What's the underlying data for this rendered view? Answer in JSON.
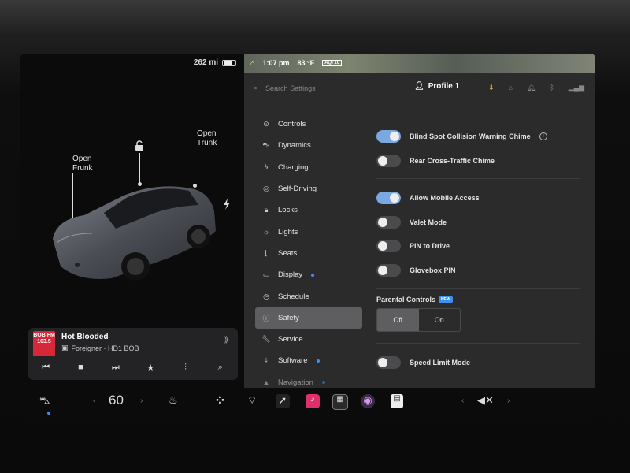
{
  "status": {
    "range": "262 mi",
    "time": "1:07 pm",
    "temp": "83 °F",
    "aqi": "AQI 10"
  },
  "car": {
    "frunk_label": "Open\nFrunk",
    "trunk_label": "Open\nTrunk"
  },
  "media": {
    "station_logo": "BOB FM 103.5",
    "song": "Hot Blooded",
    "artist": "Foreigner · HD1 BOB"
  },
  "settings": {
    "search_placeholder": "Search Settings",
    "profile": "Profile 1",
    "nav": [
      {
        "label": "Controls",
        "icon": "toggle-icon"
      },
      {
        "label": "Dynamics",
        "icon": "car-icon"
      },
      {
        "label": "Charging",
        "icon": "bolt-icon"
      },
      {
        "label": "Self-Driving",
        "icon": "steering-wheel-icon"
      },
      {
        "label": "Locks",
        "icon": "lock-icon"
      },
      {
        "label": "Lights",
        "icon": "sun-icon"
      },
      {
        "label": "Seats",
        "icon": "seat-icon"
      },
      {
        "label": "Display",
        "icon": "display-icon"
      },
      {
        "label": "Schedule",
        "icon": "clock-icon"
      },
      {
        "label": "Safety",
        "icon": "info-icon"
      },
      {
        "label": "Service",
        "icon": "wrench-icon"
      },
      {
        "label": "Software",
        "icon": "download-icon"
      },
      {
        "label": "Navigation",
        "icon": "navigation-icon"
      }
    ],
    "rows": {
      "blind_spot": "Blind Spot Collision Warning Chime",
      "rear_cross": "Rear Cross-Traffic Chime",
      "mobile_access": "Allow Mobile Access",
      "valet": "Valet Mode",
      "pin_drive": "PIN to Drive",
      "glovebox": "Glovebox PIN",
      "speed_limit": "Speed Limit Mode"
    },
    "parental": {
      "title": "Parental Controls",
      "badge": "NEW",
      "off": "Off",
      "on": "On"
    }
  },
  "dock": {
    "speed": "60"
  },
  "colors": {
    "accent": "#3e8ff2",
    "toggle_on": "#7aa8e0",
    "station": "#d62839"
  }
}
